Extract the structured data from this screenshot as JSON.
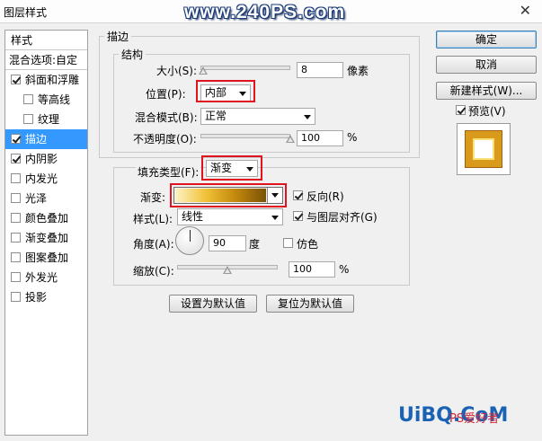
{
  "window": {
    "title": "图层样式",
    "watermark": "www.240PS.com"
  },
  "left": {
    "header": "样式",
    "blend_options": "混合选项:自定",
    "items": [
      {
        "label": "斜面和浮雕",
        "checked": true
      },
      {
        "label": "等高线",
        "checked": false
      },
      {
        "label": "纹理",
        "checked": false
      },
      {
        "label": "描边",
        "checked": true
      },
      {
        "label": "内阴影",
        "checked": true
      },
      {
        "label": "内发光",
        "checked": false
      },
      {
        "label": "光泽",
        "checked": false
      },
      {
        "label": "颜色叠加",
        "checked": false
      },
      {
        "label": "渐变叠加",
        "checked": false
      },
      {
        "label": "图案叠加",
        "checked": false
      },
      {
        "label": "外发光",
        "checked": false
      },
      {
        "label": "投影",
        "checked": false
      }
    ]
  },
  "stroke": {
    "section_title": "描边",
    "structure_title": "结构",
    "size_label": "大小(S):",
    "size_value": "8",
    "size_unit": "像素",
    "size_fraction": 0.03,
    "position_label": "位置(P):",
    "position_value": "内部",
    "blend_label": "混合模式(B):",
    "blend_value": "正常",
    "opacity_label": "不透明度(O):",
    "opacity_value": "100",
    "opacity_unit": "%",
    "opacity_fraction": 1.0
  },
  "fill": {
    "fill_type_label": "填充类型(F):",
    "fill_type_value": "渐变",
    "gradient_label": "渐变:",
    "reverse_label": "反向(R)",
    "reverse_checked": true,
    "style_label": "样式(L):",
    "style_value": "线性",
    "align_label": "与图层对齐(G)",
    "align_checked": true,
    "angle_label": "角度(A):",
    "angle_value": "90",
    "angle_unit": "度",
    "dither_label": "仿色",
    "dither_checked": false,
    "scale_label": "缩放(C):",
    "scale_value": "100",
    "scale_unit": "%",
    "scale_fraction": 0.5,
    "gradient_colors": [
      "#fcf3c4",
      "#f1c238",
      "#c2880c",
      "#7a5206"
    ]
  },
  "buttons": {
    "set_default": "设置为默认值",
    "reset_default": "复位为默认值",
    "ok": "确定",
    "cancel": "取消",
    "new_style": "新建样式(W)...",
    "preview_label": "预览(V)",
    "preview_checked": true
  },
  "branding": {
    "logo_text": "UiBQ.CoM",
    "logo_cn": "PS爱好者"
  },
  "colors": {
    "selection": "#3399ff",
    "highlight_box": "#e0141e",
    "stroke_gold": "#d99a1b"
  }
}
